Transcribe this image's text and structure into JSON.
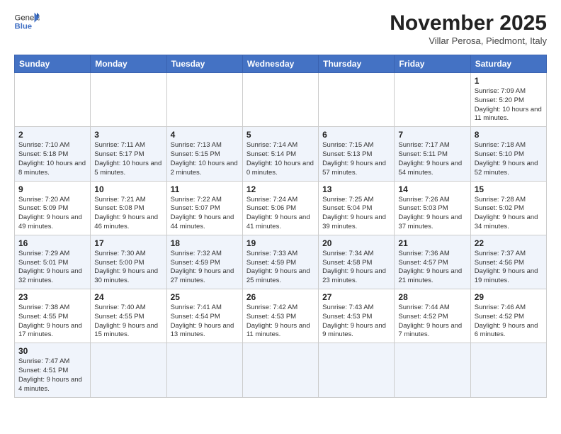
{
  "header": {
    "logo_general": "General",
    "logo_blue": "Blue",
    "month": "November 2025",
    "location": "Villar Perosa, Piedmont, Italy"
  },
  "days_of_week": [
    "Sunday",
    "Monday",
    "Tuesday",
    "Wednesday",
    "Thursday",
    "Friday",
    "Saturday"
  ],
  "weeks": [
    [
      {
        "day": "",
        "info": ""
      },
      {
        "day": "",
        "info": ""
      },
      {
        "day": "",
        "info": ""
      },
      {
        "day": "",
        "info": ""
      },
      {
        "day": "",
        "info": ""
      },
      {
        "day": "",
        "info": ""
      },
      {
        "day": "1",
        "info": "Sunrise: 7:09 AM\nSunset: 5:20 PM\nDaylight: 10 hours and 11 minutes."
      }
    ],
    [
      {
        "day": "2",
        "info": "Sunrise: 7:10 AM\nSunset: 5:18 PM\nDaylight: 10 hours and 8 minutes."
      },
      {
        "day": "3",
        "info": "Sunrise: 7:11 AM\nSunset: 5:17 PM\nDaylight: 10 hours and 5 minutes."
      },
      {
        "day": "4",
        "info": "Sunrise: 7:13 AM\nSunset: 5:15 PM\nDaylight: 10 hours and 2 minutes."
      },
      {
        "day": "5",
        "info": "Sunrise: 7:14 AM\nSunset: 5:14 PM\nDaylight: 10 hours and 0 minutes."
      },
      {
        "day": "6",
        "info": "Sunrise: 7:15 AM\nSunset: 5:13 PM\nDaylight: 9 hours and 57 minutes."
      },
      {
        "day": "7",
        "info": "Sunrise: 7:17 AM\nSunset: 5:11 PM\nDaylight: 9 hours and 54 minutes."
      },
      {
        "day": "8",
        "info": "Sunrise: 7:18 AM\nSunset: 5:10 PM\nDaylight: 9 hours and 52 minutes."
      }
    ],
    [
      {
        "day": "9",
        "info": "Sunrise: 7:20 AM\nSunset: 5:09 PM\nDaylight: 9 hours and 49 minutes."
      },
      {
        "day": "10",
        "info": "Sunrise: 7:21 AM\nSunset: 5:08 PM\nDaylight: 9 hours and 46 minutes."
      },
      {
        "day": "11",
        "info": "Sunrise: 7:22 AM\nSunset: 5:07 PM\nDaylight: 9 hours and 44 minutes."
      },
      {
        "day": "12",
        "info": "Sunrise: 7:24 AM\nSunset: 5:06 PM\nDaylight: 9 hours and 41 minutes."
      },
      {
        "day": "13",
        "info": "Sunrise: 7:25 AM\nSunset: 5:04 PM\nDaylight: 9 hours and 39 minutes."
      },
      {
        "day": "14",
        "info": "Sunrise: 7:26 AM\nSunset: 5:03 PM\nDaylight: 9 hours and 37 minutes."
      },
      {
        "day": "15",
        "info": "Sunrise: 7:28 AM\nSunset: 5:02 PM\nDaylight: 9 hours and 34 minutes."
      }
    ],
    [
      {
        "day": "16",
        "info": "Sunrise: 7:29 AM\nSunset: 5:01 PM\nDaylight: 9 hours and 32 minutes."
      },
      {
        "day": "17",
        "info": "Sunrise: 7:30 AM\nSunset: 5:00 PM\nDaylight: 9 hours and 30 minutes."
      },
      {
        "day": "18",
        "info": "Sunrise: 7:32 AM\nSunset: 4:59 PM\nDaylight: 9 hours and 27 minutes."
      },
      {
        "day": "19",
        "info": "Sunrise: 7:33 AM\nSunset: 4:59 PM\nDaylight: 9 hours and 25 minutes."
      },
      {
        "day": "20",
        "info": "Sunrise: 7:34 AM\nSunset: 4:58 PM\nDaylight: 9 hours and 23 minutes."
      },
      {
        "day": "21",
        "info": "Sunrise: 7:36 AM\nSunset: 4:57 PM\nDaylight: 9 hours and 21 minutes."
      },
      {
        "day": "22",
        "info": "Sunrise: 7:37 AM\nSunset: 4:56 PM\nDaylight: 9 hours and 19 minutes."
      }
    ],
    [
      {
        "day": "23",
        "info": "Sunrise: 7:38 AM\nSunset: 4:55 PM\nDaylight: 9 hours and 17 minutes."
      },
      {
        "day": "24",
        "info": "Sunrise: 7:40 AM\nSunset: 4:55 PM\nDaylight: 9 hours and 15 minutes."
      },
      {
        "day": "25",
        "info": "Sunrise: 7:41 AM\nSunset: 4:54 PM\nDaylight: 9 hours and 13 minutes."
      },
      {
        "day": "26",
        "info": "Sunrise: 7:42 AM\nSunset: 4:53 PM\nDaylight: 9 hours and 11 minutes."
      },
      {
        "day": "27",
        "info": "Sunrise: 7:43 AM\nSunset: 4:53 PM\nDaylight: 9 hours and 9 minutes."
      },
      {
        "day": "28",
        "info": "Sunrise: 7:44 AM\nSunset: 4:52 PM\nDaylight: 9 hours and 7 minutes."
      },
      {
        "day": "29",
        "info": "Sunrise: 7:46 AM\nSunset: 4:52 PM\nDaylight: 9 hours and 6 minutes."
      }
    ],
    [
      {
        "day": "30",
        "info": "Sunrise: 7:47 AM\nSunset: 4:51 PM\nDaylight: 9 hours and 4 minutes."
      },
      {
        "day": "",
        "info": ""
      },
      {
        "day": "",
        "info": ""
      },
      {
        "day": "",
        "info": ""
      },
      {
        "day": "",
        "info": ""
      },
      {
        "day": "",
        "info": ""
      },
      {
        "day": "",
        "info": ""
      }
    ]
  ]
}
